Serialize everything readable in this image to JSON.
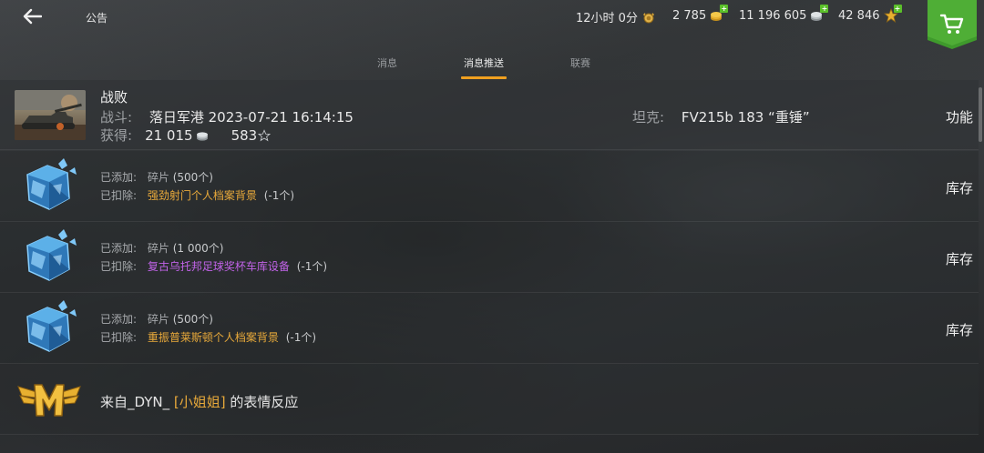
{
  "header": {
    "title": "公告",
    "timer": "12小时 0分",
    "gold": "2 785",
    "silver": "11 196 605",
    "free_xp": "42 846"
  },
  "tabs": [
    {
      "label": "消息",
      "active": false
    },
    {
      "label": "消息推送",
      "active": true
    },
    {
      "label": "联赛",
      "active": false
    }
  ],
  "battle": {
    "result": "战败",
    "battle_label": "战斗:",
    "map_time": "落日军港 2023-07-21 16:14:15",
    "earned_label": "获得:",
    "silver_earned": "21 015",
    "xp_earned": "583",
    "tank_label": "坦克:",
    "tank_name": "FV215b 183 “重锤”",
    "action": "功能"
  },
  "items": [
    {
      "added_label": "已添加:",
      "added_type": "碎片",
      "added_amount": "(500个)",
      "removed_label": "已扣除:",
      "removed_name": "强劲射门个人档案背景",
      "removed_color": "#e8a93a",
      "removed_amount": "(-1个)",
      "action": "库存"
    },
    {
      "added_label": "已添加:",
      "added_type": "碎片",
      "added_amount": "(1 000个)",
      "removed_label": "已扣除:",
      "removed_name": "复古乌托邦足球奖杯车库设备",
      "removed_color": "#c163e8",
      "removed_amount": "(-1个)",
      "action": "库存"
    },
    {
      "added_label": "已添加:",
      "added_type": "碎片",
      "added_amount": "(500个)",
      "removed_label": "已扣除:",
      "removed_name": "重振普莱斯顿个人档案背景",
      "removed_color": "#e8a93a",
      "removed_amount": "(-1个)",
      "action": "库存"
    }
  ],
  "reaction": {
    "prefix": "来自_DYN_",
    "open_bracket": "[",
    "clan": "小姐姐",
    "close_bracket": "]",
    "suffix": "的表情反应"
  },
  "colors": {
    "accent": "#f0a020",
    "shop_green": "#3f9a2c",
    "plus_green": "#5bbf2a"
  },
  "icons": [
    "back-arrow-icon",
    "timer-medal-icon",
    "gold-coins-icon",
    "silver-coins-icon",
    "free-xp-star-icon",
    "shopping-cart-icon",
    "crystal-fragment-icon",
    "m-wings-medal-icon"
  ]
}
